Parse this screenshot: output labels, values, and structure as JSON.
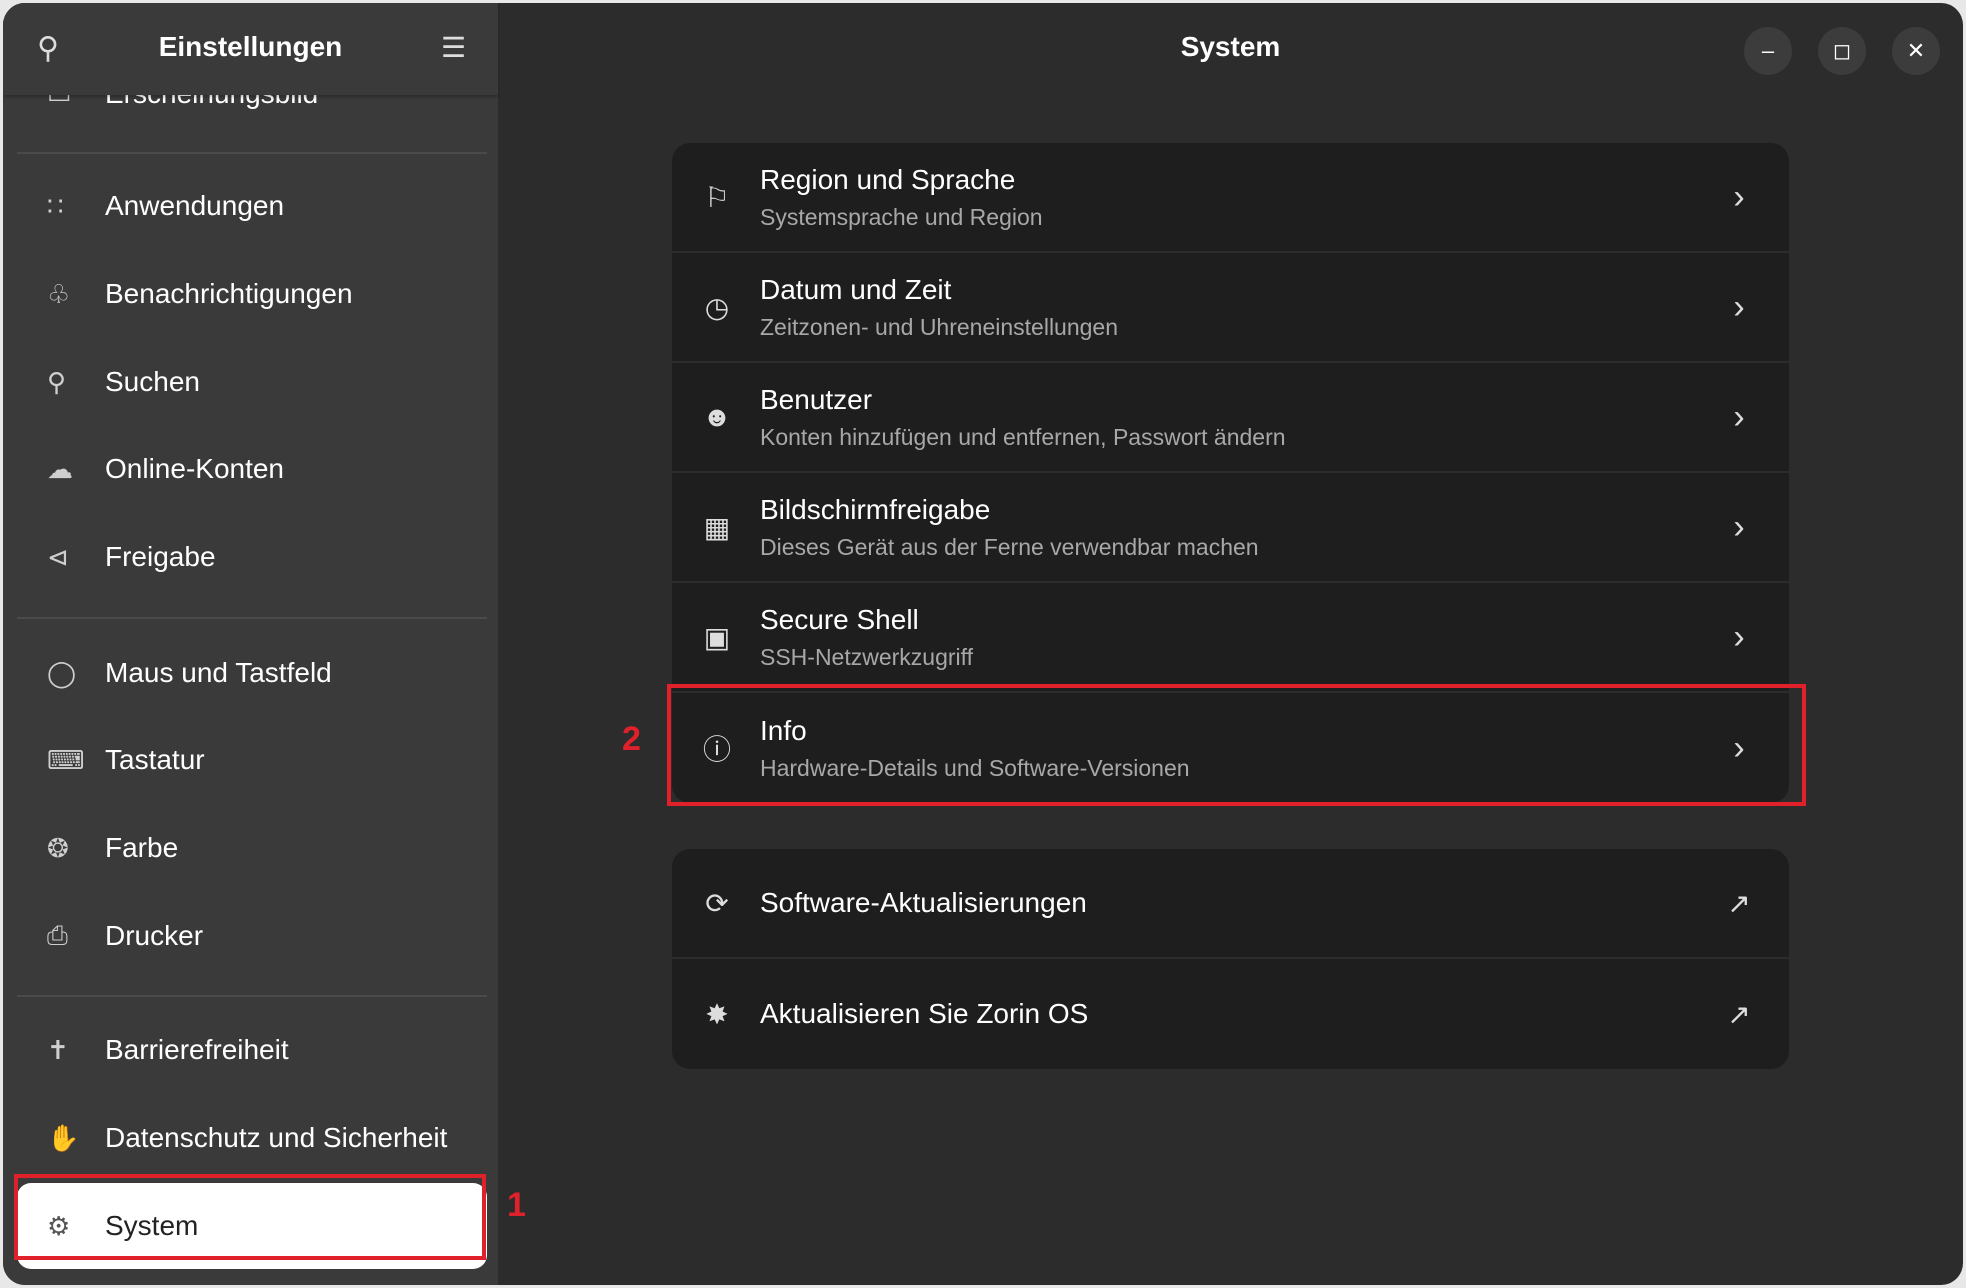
{
  "sidebar": {
    "title": "Einstellungen",
    "partial_item": "Erscheinungsbild",
    "items": [
      {
        "label": "Anwendungen",
        "icon": "grid-icon"
      },
      {
        "label": "Benachrichtigungen",
        "icon": "bell-icon"
      },
      {
        "label": "Suchen",
        "icon": "search-icon"
      },
      {
        "label": "Online-Konten",
        "icon": "cloud-icon"
      },
      {
        "label": "Freigabe",
        "icon": "share-icon"
      },
      {
        "label": "Maus und Tastfeld",
        "icon": "mouse-icon"
      },
      {
        "label": "Tastatur",
        "icon": "keyboard-icon"
      },
      {
        "label": "Farbe",
        "icon": "color-icon"
      },
      {
        "label": "Drucker",
        "icon": "printer-icon"
      },
      {
        "label": "Barrierefreiheit",
        "icon": "accessibility-icon"
      },
      {
        "label": "Datenschutz und Sicherheit",
        "icon": "hand-icon"
      },
      {
        "label": "System",
        "icon": "gear-icon",
        "selected": true
      }
    ]
  },
  "header": {
    "title": "System"
  },
  "main": {
    "group1": [
      {
        "title": "Region und Sprache",
        "subtitle": "Systemsprache und Region",
        "icon": "flag-icon"
      },
      {
        "title": "Datum und Zeit",
        "subtitle": "Zeitzonen- und Uhreneinstellungen",
        "icon": "clock-icon"
      },
      {
        "title": "Benutzer",
        "subtitle": "Konten hinzufügen und entfernen, Passwort ändern",
        "icon": "users-icon"
      },
      {
        "title": "Bildschirmfreigabe",
        "subtitle": "Dieses Gerät aus der Ferne verwendbar machen",
        "icon": "screen-share-icon"
      },
      {
        "title": "Secure Shell",
        "subtitle": "SSH-Netzwerkzugriff",
        "icon": "terminal-icon"
      },
      {
        "title": "Info",
        "subtitle": "Hardware-Details und Software-Versionen",
        "icon": "info-icon"
      }
    ],
    "group2": [
      {
        "title": "Software-Aktualisierungen",
        "icon": "refresh-icon"
      },
      {
        "title": "Aktualisieren Sie Zorin OS",
        "icon": "upgrade-icon"
      }
    ]
  },
  "annotations": {
    "marker1": "1",
    "marker2": "2",
    "color": "#e0202a"
  }
}
